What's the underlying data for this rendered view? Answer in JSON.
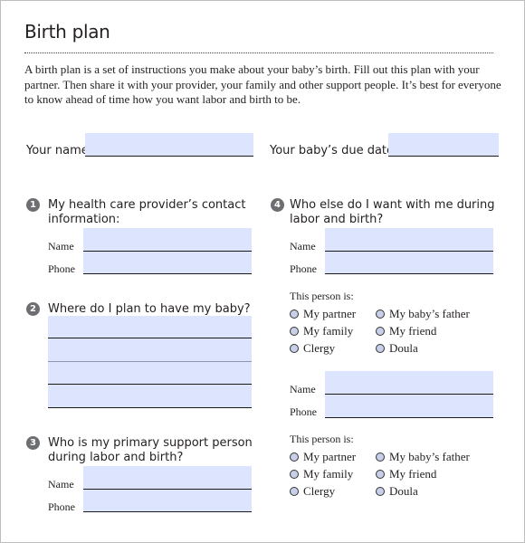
{
  "title": "Birth plan",
  "intro": "A birth plan is a set of instructions you make about your baby’s birth. Fill out this plan with your partner. Then share it with your provider, your family and other support people. It’s best for everyone to know ahead of time how you want labor and birth to be.",
  "top_fields": {
    "your_name_label": "Your name",
    "your_name_value": "",
    "due_date_label": "Your baby’s due date",
    "due_date_value": ""
  },
  "field_color": "#dde4fd",
  "badge_color": "#6d6e71",
  "sections": [
    {
      "number": "1",
      "question": "My health care provider’s contact information:",
      "name_label": "Name",
      "phone_label": "Phone"
    },
    {
      "number": "2",
      "question": "Where do I plan to have my baby?",
      "lines": [
        "",
        "",
        "",
        ""
      ]
    },
    {
      "number": "3",
      "question": "Who is my primary support person during labor and birth?",
      "name_label": "Name",
      "phone_label": "Phone"
    },
    {
      "number": "4",
      "question": "Who else do I want with me during labor and birth?",
      "persons": [
        {
          "name_label": "Name",
          "phone_label": "Phone",
          "this_person_label": "This person is:",
          "options": [
            "My partner",
            "My baby’s father",
            "My family",
            "My friend",
            "Clergy",
            "Doula"
          ],
          "selected": null
        },
        {
          "name_label": "Name",
          "phone_label": "Phone",
          "this_person_label": "This person is:",
          "options": [
            "My partner",
            "My baby’s father",
            "My family",
            "My friend",
            "Clergy",
            "Doula"
          ],
          "selected": null
        }
      ]
    }
  ]
}
